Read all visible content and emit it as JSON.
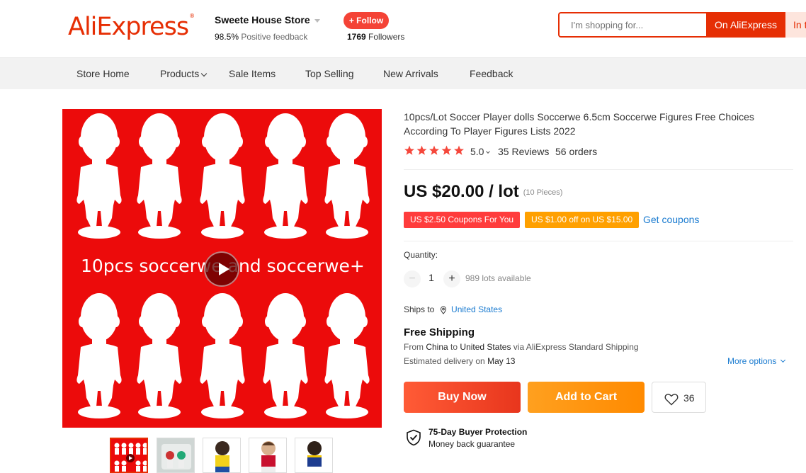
{
  "header": {
    "logo": "AliExpress",
    "store_name": "Sweete House Store",
    "feedback_percent": "98.5%",
    "feedback_label": "Positive feedback",
    "follow_label": "+ Follow",
    "followers_count": "1769",
    "followers_label": "Followers",
    "search_placeholder": "I'm shopping for...",
    "search_ali_label": "On AliExpress",
    "search_store_label": "In this store"
  },
  "nav": {
    "items": [
      "Store Home",
      "Products",
      "Sale Items",
      "Top Selling",
      "New Arrivals",
      "Feedback"
    ]
  },
  "product": {
    "image_overlay_text": "10pcs soccerwe and soccerwe+",
    "title": "10pcs/Lot Soccer Player dolls Soccerwe 6.5cm Soccerwe Figures Free Choices According To Player Figures Lists 2022",
    "rating": "5.0",
    "reviews": "35 Reviews",
    "orders": "56 orders",
    "price": "US $20.00 / lot",
    "price_unit": "(10 Pieces)",
    "coupon1": "US $2.50 Coupons For You",
    "coupon2": "US $1.00 off on US $15.00",
    "get_coupons": "Get coupons",
    "quantity_label": "Quantity:",
    "quantity_value": "1",
    "minus": "−",
    "plus": "+",
    "lots_available": "989 lots available",
    "ships_to_label": "Ships to",
    "ships_to_country": "United States",
    "free_shipping": "Free Shipping",
    "ship_prefix": "From",
    "ship_from": "China",
    "ship_to_word": "to",
    "ship_to": "United States",
    "ship_via": "via AliExpress Standard Shipping",
    "delivery_prefix": "Estimated delivery on",
    "delivery_date": "May 13",
    "more_options": "More options",
    "buy_now": "Buy Now",
    "add_to_cart": "Add to Cart",
    "wishlist_count": "36",
    "protection_title": "75-Day Buyer Protection",
    "protection_sub": "Money back guarantee"
  },
  "colors": {
    "brand": "#e62e04",
    "image_bg": "#ec0b0b",
    "link": "#1a7bd0",
    "coupon_red": "#ff3c3c",
    "coupon_orange": "#ffa000",
    "star": "#f5473b"
  },
  "icons": [
    "play-icon",
    "pin-icon",
    "heart-icon",
    "shield-check-icon",
    "star-icon",
    "chevron-down-icon"
  ]
}
